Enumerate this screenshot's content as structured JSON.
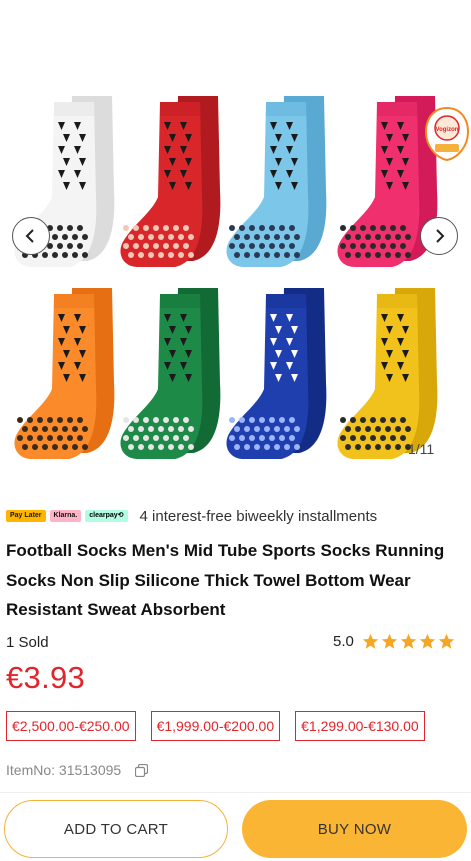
{
  "gallery": {
    "counter": "1/11",
    "badge_text": "Vogizon",
    "sock_colors": [
      {
        "name": "white",
        "body": "#f4f4f4",
        "shade": "#dcdcdc",
        "mark": "#1a1a1a",
        "grip": "#2a2a2a"
      },
      {
        "name": "red",
        "body": "#d9262b",
        "shade": "#b11b20",
        "mark": "#1a1a1a",
        "grip": "#f2c7b5"
      },
      {
        "name": "sky-blue",
        "body": "#7cc6ea",
        "shade": "#5aa9d3",
        "mark": "#1a1a1a",
        "grip": "#2a3a55"
      },
      {
        "name": "pink",
        "body": "#f0306e",
        "shade": "#d21b58",
        "mark": "#1a1a1a",
        "grip": "#2a2a2a"
      },
      {
        "name": "orange",
        "body": "#fb8a2a",
        "shade": "#e56f12",
        "mark": "#1a1a1a",
        "grip": "#3a2a1a"
      },
      {
        "name": "green",
        "body": "#1e8a48",
        "shade": "#126b35",
        "mark": "#1a1a1a",
        "grip": "#e6e6e6"
      },
      {
        "name": "royal-blue",
        "body": "#1f3fae",
        "shade": "#132c86",
        "mark": "#ffffff",
        "grip": "#9db4ff"
      },
      {
        "name": "yellow",
        "body": "#f2c21c",
        "shade": "#d8a70a",
        "mark": "#1a1a1a",
        "grip": "#2a2a2a"
      }
    ]
  },
  "payment": {
    "chips": [
      "Pay Later",
      "Klarna.",
      "clearpay⟲"
    ],
    "installments_text": "4 interest-free biweekly installments"
  },
  "product": {
    "title": "Football Socks Men's Mid Tube Sports Socks Running Socks Non Slip Silicone Thick Towel Bottom Wear Resistant Sweat Absorbent",
    "sold": "1 Sold",
    "rating": "5.0",
    "stars": 5,
    "price": "€3.93",
    "coupons": [
      "€2,500.00-€250.00",
      "€1,999.00-€200.00",
      "€1,299.00-€130.00"
    ],
    "item_no": "ItemNo: 31513095"
  },
  "actions": {
    "add_to_cart": "ADD TO CART",
    "buy_now": "BUY NOW"
  },
  "colors": {
    "price_red": "#e0252b",
    "accent_yellow": "#fbb534",
    "star": "#f5a623"
  }
}
